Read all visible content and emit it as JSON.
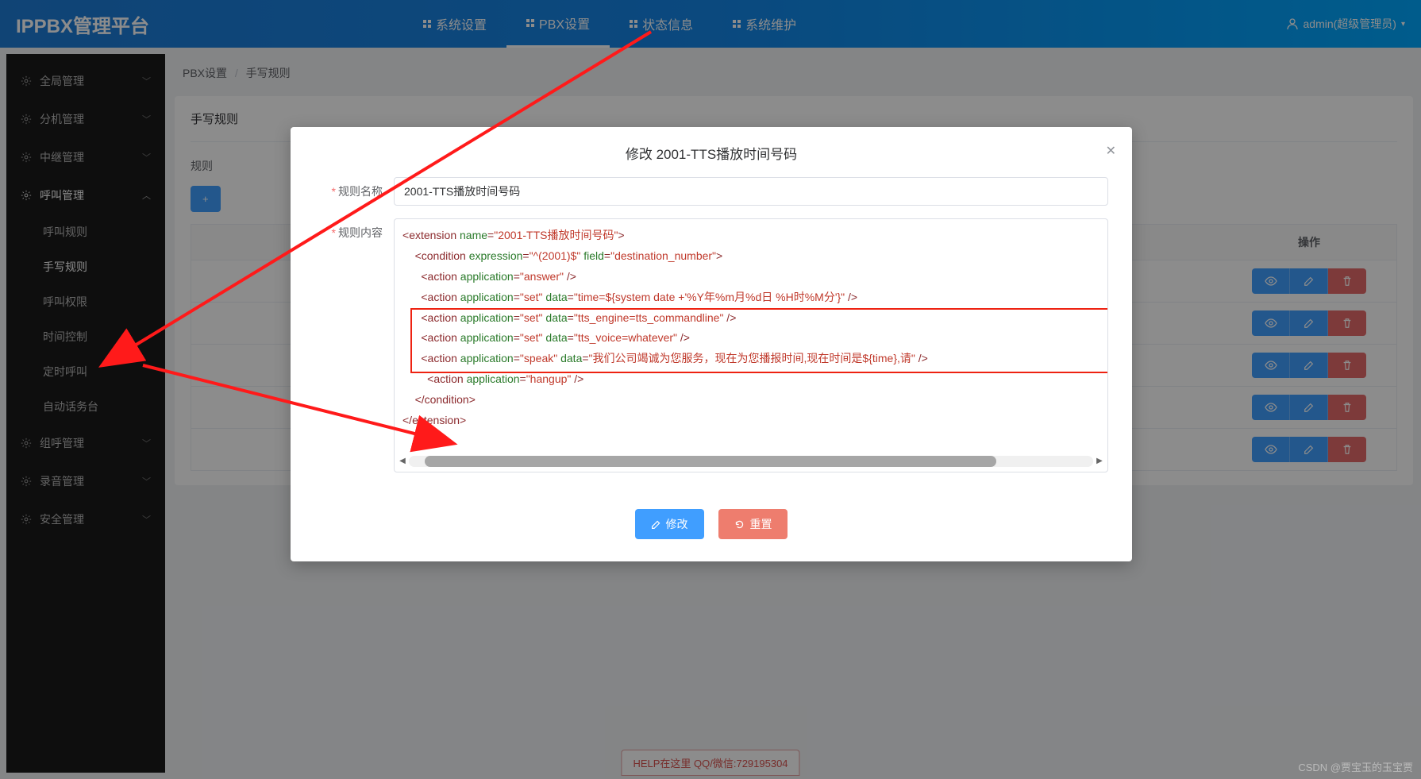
{
  "app_title": "IPPBX管理平台",
  "topnav": {
    "items": [
      {
        "label": "系统设置"
      },
      {
        "label": "PBX设置",
        "active": true
      },
      {
        "label": "状态信息"
      },
      {
        "label": "系统维护"
      }
    ],
    "user": "admin(超级管理员)"
  },
  "sidebar": {
    "groups": [
      {
        "label": "全局管理",
        "expanded": false
      },
      {
        "label": "分机管理",
        "expanded": false
      },
      {
        "label": "中继管理",
        "expanded": false
      },
      {
        "label": "呼叫管理",
        "expanded": true,
        "children": [
          {
            "label": "呼叫规则"
          },
          {
            "label": "手写规则",
            "active": true
          },
          {
            "label": "呼叫权限"
          },
          {
            "label": "时间控制"
          },
          {
            "label": "定时呼叫"
          },
          {
            "label": "自动话务台"
          }
        ]
      },
      {
        "label": "组呼管理",
        "expanded": false
      },
      {
        "label": "录音管理",
        "expanded": false
      },
      {
        "label": "安全管理",
        "expanded": false
      }
    ]
  },
  "breadcrumb": {
    "a": "PBX设置",
    "b": "手写规则"
  },
  "card": {
    "title": "手写规则",
    "search_label": "规则",
    "ops_header": "操作"
  },
  "rows": 5,
  "modal": {
    "title": "修改 2001-TTS播放时间号码",
    "label_name": "规则名称",
    "label_content": "规则内容",
    "name_value": "2001-TTS播放时间号码",
    "btn_edit": "修改",
    "btn_reset": "重置"
  },
  "code": {
    "ext_name": "2001-TTS播放时间号码",
    "cond_expr": "^(2001)$",
    "cond_field": "destination_number",
    "actions": [
      {
        "application": "answer"
      },
      {
        "application": "set",
        "data": "time=${system date +'%Y年%m月%d日 %H时%M分'}"
      },
      {
        "application": "set",
        "data": "tts_engine=tts_commandline"
      },
      {
        "application": "set",
        "data": "tts_voice=whatever"
      },
      {
        "application": "speak",
        "data": "我们公司竭诚为您服务，现在为您播报时间,现在时间是${time},请"
      },
      {
        "application": "hangup"
      }
    ]
  },
  "footer_help": "HELP在这里 QQ/微信:729195304",
  "watermark": "CSDN @贾宝玉的玉宝贾"
}
